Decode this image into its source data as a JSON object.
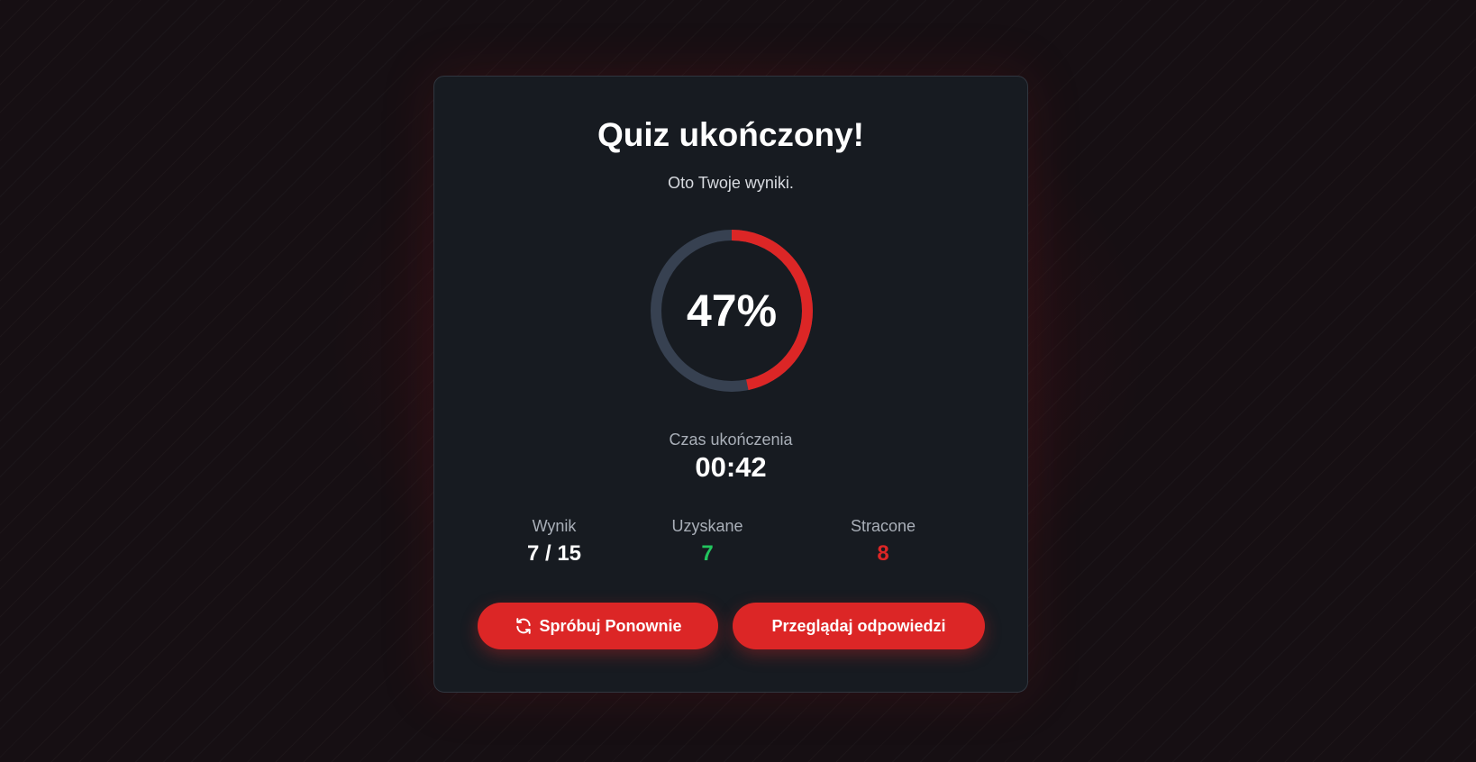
{
  "results": {
    "title": "Quiz ukończony!",
    "subtitle": "Oto Twoje wyniki.",
    "percent_label": "47%",
    "progress_fraction": 0.4667,
    "time_label": "Czas ukończenia",
    "time_value": "00:42"
  },
  "stats": {
    "score_label": "Wynik",
    "score_value": "7 / 15",
    "gained_label": "Uzyskane",
    "gained_value": "7",
    "lost_label": "Stracone",
    "lost_value": "8"
  },
  "actions": {
    "retry_label": "Spróbuj Ponownie",
    "retry_icon": "refresh-icon",
    "review_label": "Przeglądaj odpowiedzi"
  },
  "colors": {
    "accent": "#dc2626",
    "ring_track": "#374151",
    "positive": "#22c55e",
    "negative": "#dc2626"
  }
}
